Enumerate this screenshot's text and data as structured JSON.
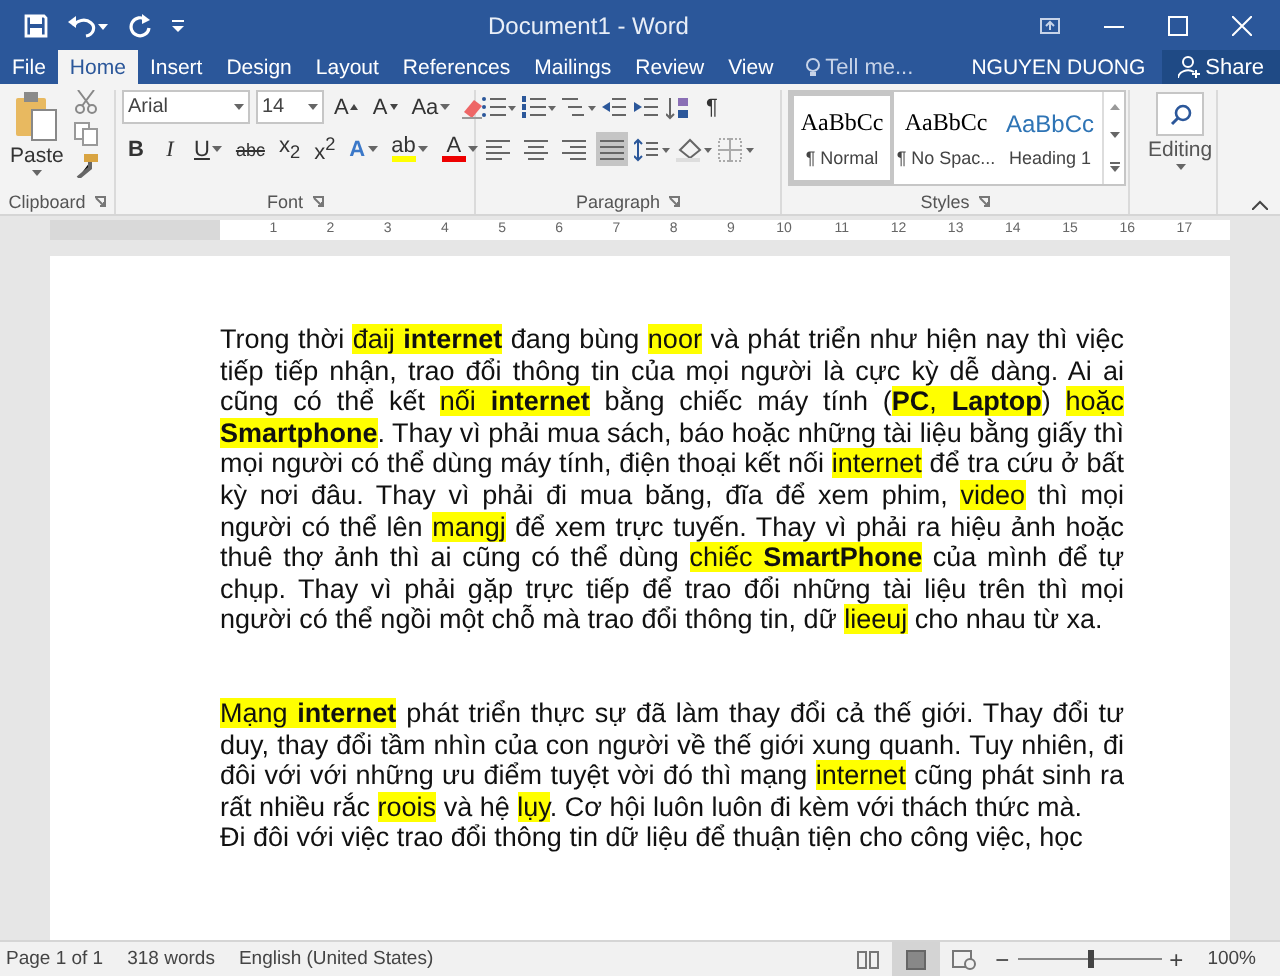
{
  "window": {
    "title": "Document1 - Word"
  },
  "tabs": [
    {
      "label": "File",
      "selected": false
    },
    {
      "label": "Home",
      "selected": true
    },
    {
      "label": "Insert",
      "selected": false
    },
    {
      "label": "Design",
      "selected": false
    },
    {
      "label": "Layout",
      "selected": false
    },
    {
      "label": "References",
      "selected": false
    },
    {
      "label": "Mailings",
      "selected": false
    },
    {
      "label": "Review",
      "selected": false
    },
    {
      "label": "View",
      "selected": false
    }
  ],
  "tell_me": {
    "placeholder": "Tell me..."
  },
  "user": "NGUYEN DUONG",
  "share": "Share",
  "ribbon": {
    "clipboard": {
      "paste": "Paste",
      "label": "Clipboard"
    },
    "font": {
      "font_name": "Arial",
      "font_size": "14",
      "grow": "A",
      "shrink": "A",
      "change_case": "Aa",
      "bold": "B",
      "italic": "I",
      "underline": "U",
      "strikethrough": "abc",
      "subscript": "x$_{2}$",
      "superscript": "x$^{2}$",
      "text_effects": "A",
      "highlight": "ab",
      "font_color": "A",
      "label": "Font"
    },
    "paragraph": {
      "pilcrow": "¶",
      "alignments": [
        {
          "kind": "left",
          "selected": false
        },
        {
          "kind": "center",
          "selected": false
        },
        {
          "kind": "right",
          "selected": false
        },
        {
          "kind": "justify",
          "selected": true
        }
      ],
      "label": "Paragraph"
    },
    "styles": {
      "items": [
        {
          "sample": "AaBbCc",
          "name": "¶ Normal",
          "kind": "normal",
          "selected": true
        },
        {
          "sample": "AaBbCc",
          "name": "¶ No Spac...",
          "kind": "normal",
          "selected": false
        },
        {
          "sample": "AaBbCc",
          "name": "Heading 1",
          "kind": "heading",
          "selected": false
        }
      ],
      "label": "Styles"
    },
    "editing": {
      "label": "Editing"
    }
  },
  "ruler": {
    "numbers": [
      "1",
      "2",
      "3",
      "4",
      "5",
      "6",
      "7",
      "8",
      "9",
      "10",
      "11",
      "12",
      "13",
      "14",
      "15",
      "16",
      "17"
    ]
  },
  "document": {
    "paragraphs": [
      {
        "runs": [
          {
            "text": "Trong thời "
          },
          {
            "text": "đaij ",
            "highlight": true
          },
          {
            "text": "internet",
            "highlight": true,
            "bold": true
          },
          {
            "text": " đang bùng "
          },
          {
            "text": "noor",
            "highlight": true
          },
          {
            "text": " và phát triển như hiện nay thì việc tiếp tiếp nhận, trao đổi thông tin của mọi người là cực kỳ dễ dàng. Ai ai cũng có thể kết "
          },
          {
            "text": "nối ",
            "highlight": true
          },
          {
            "text": "internet",
            "highlight": true,
            "bold": true
          },
          {
            "text": " bằng chiếc máy tính ("
          },
          {
            "text": "PC",
            "highlight": true,
            "bold": true
          },
          {
            "text": ", ",
            "highlight": true
          },
          {
            "text": "Laptop",
            "highlight": true,
            "bold": true
          },
          {
            "text": ") "
          },
          {
            "text": "hoặc ",
            "highlight": true
          },
          {
            "text": "Smartphone",
            "highlight": true,
            "bold": true
          },
          {
            "text": ". Thay vì phải mua sách, báo hoặc những tài liệu bằng giấy thì mọi người có thể dùng máy tính, điện thoại kết nối "
          },
          {
            "text": "internet",
            "highlight": true
          },
          {
            "text": " để tra cứu ở bất kỳ nơi đâu. Thay vì phải đi mua băng, đĩa để xem phim, "
          },
          {
            "text": "video",
            "highlight": true
          },
          {
            "text": " thì mọi người có thể lên "
          },
          {
            "text": "mangj",
            "highlight": true
          },
          {
            "text": " để xem trực tuyến. Thay vì phải ra hiệu ảnh hoặc thuê thợ ảnh thì ai cũng có thể dùng "
          },
          {
            "text": "chiếc ",
            "highlight": true
          },
          {
            "text": "SmartPhone",
            "highlight": true,
            "bold": true
          },
          {
            "text": " của mình để tự chụp. Thay vì phải gặp trực tiếp để trao đổi những tài liệu trên thì mọi người có thể ngồi một chỗ mà trao đổi thông tin, dữ "
          },
          {
            "text": "lieeuj",
            "highlight": true
          },
          {
            "text": " cho nhau từ xa."
          }
        ]
      },
      {
        "runs": [
          {
            "text": "Mạng ",
            "highlight": true
          },
          {
            "text": "internet",
            "highlight": true,
            "bold": true
          },
          {
            "text": " phát triển thực sự đã làm thay đổi cả thế giới. Thay đổi tư duy, thay đổi tầm nhìn của con người về thế giới xung quanh. Tuy nhiên, đi đôi với với những ưu điểm tuyệt vời đó thì mạng "
          },
          {
            "text": "internet",
            "highlight": true
          },
          {
            "text": " cũng phát sinh ra rất nhiều rắc "
          },
          {
            "text": "roois",
            "highlight": true
          },
          {
            "text": " và hệ "
          },
          {
            "text": "lụy",
            "highlight": true
          },
          {
            "text": ". Cơ hội luôn luôn đi kèm với thách thức mà."
          }
        ]
      },
      {
        "runs": [
          {
            "text": "Đi đôi với việc trao đổi thông tin dữ liệu để thuận tiện cho công việc, học"
          }
        ]
      }
    ]
  },
  "status_bar": {
    "page": "Page 1 of 1",
    "words": "318 words",
    "language": "English (United States)",
    "views": [
      {
        "kind": "read",
        "selected": false
      },
      {
        "kind": "print",
        "selected": true
      },
      {
        "kind": "web",
        "selected": false
      }
    ],
    "zoom": {
      "level": 0.5,
      "minus": "−",
      "plus": "+",
      "reading": "100%"
    }
  }
}
